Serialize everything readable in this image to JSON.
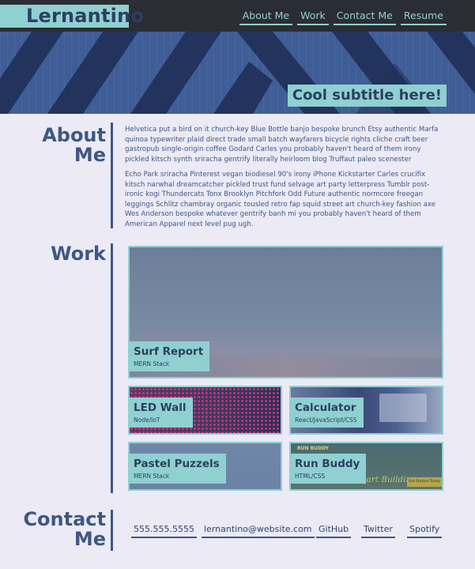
{
  "header": {
    "logo": "Lernantino",
    "nav": [
      "About Me",
      "Work",
      "Contact Me",
      "Resume"
    ],
    "subtitle": "Cool subtitle here!"
  },
  "about": {
    "title_line1": "About",
    "title_line2": "Me",
    "paragraphs": [
      "Helvetica put a bird on it church-key Blue Bottle banjo bespoke brunch Etsy authentic Marfa quinoa typewriter plaid direct trade small batch wayfarers bicycle rights cliche craft beer gastropub single-origin coffee Godard Carles you probably haven't heard of them irony pickled kitsch synth sriracha gentrify literally heirloom blog Truffaut paleo scenester",
      "Echo Park sriracha Pinterest vegan biodiesel 90's irony iPhone Kickstarter Carles crucifix kitsch narwhal dreamcatcher pickled trust fund selvage art party letterpress Tumblr post-ironic kogi Thundercats Tonx Brooklyn Pitchfork Odd Future authentic normcore freegan leggings Schlitz chambray organic tousled retro fap squid street art church-key fashion axe Wes Anderson bespoke whatever gentrify banh mi you probably haven't heard of them American Apparel next level pug ugh."
    ]
  },
  "work": {
    "title": "Work",
    "projects": [
      {
        "name": "Surf Report",
        "stack": "MERN Stack"
      },
      {
        "name": "LED Wall",
        "stack": "Node/IoT"
      },
      {
        "name": "Calculator",
        "stack": "React/JavaScript/CSS"
      },
      {
        "name": "Pastel Puzzels",
        "stack": "MERN Stack"
      },
      {
        "name": "Run Buddy",
        "stack": "HTML/CSS"
      }
    ],
    "run_buddy_screenshot_text": {
      "brand": "RUN BUDDY",
      "headline": "Start Building",
      "cta": "Get Started Today"
    }
  },
  "contact": {
    "title_line1": "Contact",
    "title_line2": "Me",
    "links": [
      "555.555.5555",
      "lernantino@website.com",
      "GitHub",
      "Twitter",
      "Spotify"
    ]
  },
  "colors": {
    "accent": "#8fd0d0",
    "navy": "#3f5783",
    "header_bg": "#2b2d34",
    "page_bg": "#ebeaf5"
  }
}
